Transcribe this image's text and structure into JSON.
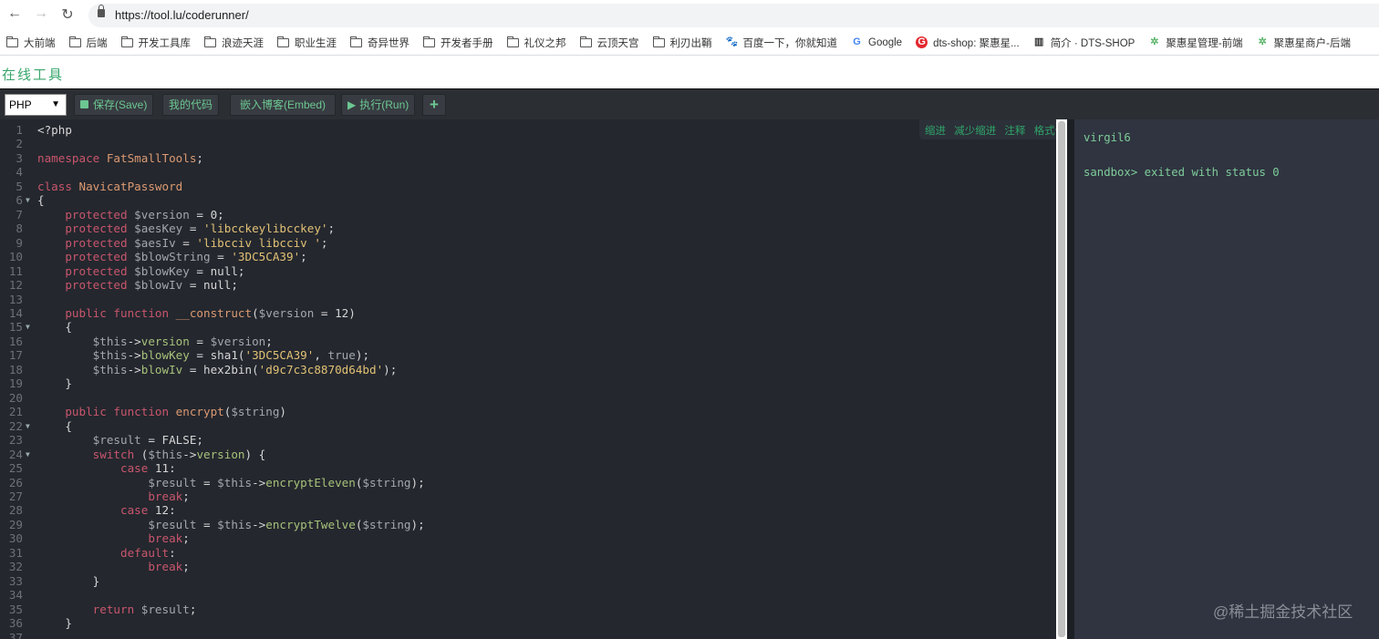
{
  "browser": {
    "url": "https://tool.lu/coderunner/",
    "bookmarks": [
      {
        "label": "大前端",
        "icon": "folder-icon"
      },
      {
        "label": "后端",
        "icon": "folder-icon"
      },
      {
        "label": "开发工具库",
        "icon": "folder-icon"
      },
      {
        "label": "浪迹天涯",
        "icon": "folder-icon"
      },
      {
        "label": "职业生涯",
        "icon": "folder-icon"
      },
      {
        "label": "奇异世界",
        "icon": "folder-icon"
      },
      {
        "label": "开发者手册",
        "icon": "folder-icon"
      },
      {
        "label": "礼仪之邦",
        "icon": "folder-icon"
      },
      {
        "label": "云顶天宫",
        "icon": "folder-icon"
      },
      {
        "label": "利刃出鞘",
        "icon": "folder-icon"
      },
      {
        "label": "百度一下，你就知道",
        "icon": "baidu-icon"
      },
      {
        "label": "Google",
        "icon": "google-icon"
      },
      {
        "label": "dts-shop: 聚惠星...",
        "icon": "dts-icon"
      },
      {
        "label": "简介 · DTS-SHOP",
        "icon": "book-icon"
      },
      {
        "label": "聚惠星管理-前端",
        "icon": "star-logo-icon"
      },
      {
        "label": "聚惠星商户-后端",
        "icon": "star-logo-icon"
      }
    ]
  },
  "site": {
    "title": "在线工具"
  },
  "toolbar": {
    "language": "PHP",
    "save": "保存(Save)",
    "my_code": "我的代码",
    "embed": "嵌入博客(Embed)",
    "run": "执行(Run)",
    "add": "+"
  },
  "editor_actions": [
    "缩进",
    "减少缩进",
    "注释",
    "格式化"
  ],
  "editor": {
    "folds": [
      6,
      15,
      22,
      24
    ],
    "lines": [
      [
        [
          "p",
          "<?php"
        ]
      ],
      [],
      [
        [
          "k",
          "namespace "
        ],
        [
          "c",
          "FatSmallTools"
        ],
        [
          "p",
          ";"
        ]
      ],
      [],
      [
        [
          "k",
          "class "
        ],
        [
          "c",
          "NavicatPassword"
        ]
      ],
      [
        [
          "p",
          "{"
        ]
      ],
      [
        [
          "p",
          "    "
        ],
        [
          "k",
          "protected "
        ],
        [
          "v",
          "$version"
        ],
        [
          "p",
          " = 0;"
        ]
      ],
      [
        [
          "p",
          "    "
        ],
        [
          "k",
          "protected "
        ],
        [
          "v",
          "$aesKey"
        ],
        [
          "p",
          " = "
        ],
        [
          "s",
          "'libcckeylibcckey'"
        ],
        [
          "p",
          ";"
        ]
      ],
      [
        [
          "p",
          "    "
        ],
        [
          "k",
          "protected "
        ],
        [
          "v",
          "$aesIv"
        ],
        [
          "p",
          " = "
        ],
        [
          "s",
          "'libcciv libcciv '"
        ],
        [
          "p",
          ";"
        ]
      ],
      [
        [
          "p",
          "    "
        ],
        [
          "k",
          "protected "
        ],
        [
          "v",
          "$blowString"
        ],
        [
          "p",
          " = "
        ],
        [
          "s",
          "'3DC5CA39'"
        ],
        [
          "p",
          ";"
        ]
      ],
      [
        [
          "p",
          "    "
        ],
        [
          "k",
          "protected "
        ],
        [
          "v",
          "$blowKey"
        ],
        [
          "p",
          " = null;"
        ]
      ],
      [
        [
          "p",
          "    "
        ],
        [
          "k",
          "protected "
        ],
        [
          "v",
          "$blowIv"
        ],
        [
          "p",
          " = null;"
        ]
      ],
      [],
      [
        [
          "p",
          "    "
        ],
        [
          "k",
          "public function "
        ],
        [
          "c",
          "__construct"
        ],
        [
          "p",
          "("
        ],
        [
          "v",
          "$version"
        ],
        [
          "p",
          " = 12)"
        ]
      ],
      [
        [
          "p",
          "    {"
        ]
      ],
      [
        [
          "p",
          "        "
        ],
        [
          "v",
          "$this"
        ],
        [
          "p",
          "->"
        ],
        [
          "g",
          "version"
        ],
        [
          "p",
          " = "
        ],
        [
          "v",
          "$version"
        ],
        [
          "p",
          ";"
        ]
      ],
      [
        [
          "p",
          "        "
        ],
        [
          "v",
          "$this"
        ],
        [
          "p",
          "->"
        ],
        [
          "g",
          "blowKey"
        ],
        [
          "p",
          " = sha1("
        ],
        [
          "s",
          "'3DC5CA39'"
        ],
        [
          "p",
          ", "
        ],
        [
          "v",
          "true"
        ],
        [
          "p",
          ");"
        ]
      ],
      [
        [
          "p",
          "        "
        ],
        [
          "v",
          "$this"
        ],
        [
          "p",
          "->"
        ],
        [
          "g",
          "blowIv"
        ],
        [
          "p",
          " = hex2bin("
        ],
        [
          "s",
          "'d9c7c3c8870d64bd'"
        ],
        [
          "p",
          ");"
        ]
      ],
      [
        [
          "p",
          "    }"
        ]
      ],
      [],
      [
        [
          "p",
          "    "
        ],
        [
          "k",
          "public function "
        ],
        [
          "c",
          "encrypt"
        ],
        [
          "p",
          "("
        ],
        [
          "v",
          "$string"
        ],
        [
          "p",
          ")"
        ]
      ],
      [
        [
          "p",
          "    {"
        ]
      ],
      [
        [
          "p",
          "        "
        ],
        [
          "v",
          "$result"
        ],
        [
          "p",
          " = FALSE;"
        ]
      ],
      [
        [
          "p",
          "        "
        ],
        [
          "k",
          "switch "
        ],
        [
          "p",
          "("
        ],
        [
          "v",
          "$this"
        ],
        [
          "p",
          "->"
        ],
        [
          "g",
          "version"
        ],
        [
          "p",
          ") {"
        ]
      ],
      [
        [
          "p",
          "            "
        ],
        [
          "k",
          "case "
        ],
        [
          "p",
          "11:"
        ]
      ],
      [
        [
          "p",
          "                "
        ],
        [
          "v",
          "$result"
        ],
        [
          "p",
          " = "
        ],
        [
          "v",
          "$this"
        ],
        [
          "p",
          "->"
        ],
        [
          "g",
          "encryptEleven"
        ],
        [
          "p",
          "("
        ],
        [
          "v",
          "$string"
        ],
        [
          "p",
          ");"
        ]
      ],
      [
        [
          "p",
          "                "
        ],
        [
          "k",
          "break"
        ],
        [
          "p",
          ";"
        ]
      ],
      [
        [
          "p",
          "            "
        ],
        [
          "k",
          "case "
        ],
        [
          "p",
          "12:"
        ]
      ],
      [
        [
          "p",
          "                "
        ],
        [
          "v",
          "$result"
        ],
        [
          "p",
          " = "
        ],
        [
          "v",
          "$this"
        ],
        [
          "p",
          "->"
        ],
        [
          "g",
          "encryptTwelve"
        ],
        [
          "p",
          "("
        ],
        [
          "v",
          "$string"
        ],
        [
          "p",
          ");"
        ]
      ],
      [
        [
          "p",
          "                "
        ],
        [
          "k",
          "break"
        ],
        [
          "p",
          ";"
        ]
      ],
      [
        [
          "p",
          "            "
        ],
        [
          "k",
          "default"
        ],
        [
          "p",
          ":"
        ]
      ],
      [
        [
          "p",
          "                "
        ],
        [
          "k",
          "break"
        ],
        [
          "p",
          ";"
        ]
      ],
      [
        [
          "p",
          "        }"
        ]
      ],
      [],
      [
        [
          "p",
          "        "
        ],
        [
          "k",
          "return "
        ],
        [
          "v",
          "$result"
        ],
        [
          "p",
          ";"
        ]
      ],
      [
        [
          "p",
          "    }"
        ]
      ],
      []
    ]
  },
  "output": {
    "lines": [
      "virgil6",
      "sandbox> exited with status 0"
    ]
  },
  "watermark": "@稀土掘金技术社区"
}
